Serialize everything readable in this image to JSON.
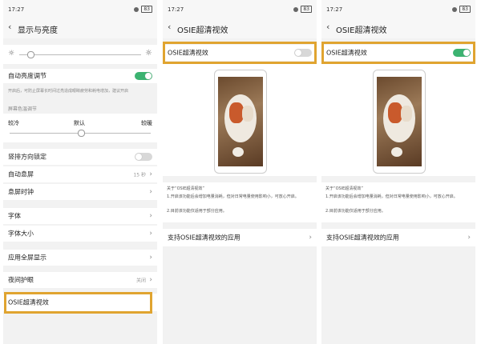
{
  "status": {
    "time": "17:27",
    "indicators": "",
    "battery": "83"
  },
  "screen1": {
    "title": "显示与亮度",
    "auto_brightness": "自动亮度调节",
    "auto_desc": "开启后，可防止屏幕长时间过亮造成眼睛疲劳和耗电增加，建议开启",
    "color_temp_label": "屏幕色温调节",
    "temp_cool": "较冷",
    "temp_default": "默认",
    "temp_warm": "较暖",
    "portrait_lock": "竖排方向锁定",
    "auto_sleep": "自动息屏",
    "auto_sleep_value": "15 秒",
    "sleep_timer": "息屏时钟",
    "font": "字体",
    "font_size": "字体大小",
    "fullscreen": "应用全屏显示",
    "night_mode": "夜间护眼",
    "night_value": "关闭",
    "osie": "OSIE超清视效"
  },
  "screen2": {
    "title": "OSIE超清视效",
    "toggle_label": "OSIE超清视效",
    "about_title": "关于“OSIE超清视效”",
    "about_1": "1.开启该功能后会增加电量消耗，但对日常电量使用影响小，可放心开启。",
    "about_2": "2.目前该功能仅适用于部分应用。",
    "supported": "支持OSIE超清视效的应用"
  },
  "screen3": {
    "title": "OSIE超清视效",
    "toggle_label": "OSIE超清视效",
    "about_title": "关于“OSIE超清视效”",
    "about_1": "1.开启该功能后会增加电量消耗，但对日常电量使用影响小，可放心开启。",
    "about_2": "2.目前该功能仅适用于部分应用。",
    "supported": "支持OSIE超清视效的应用"
  },
  "colors": {
    "highlight": "#e0a430",
    "toggle_on": "#3cb371"
  },
  "icons": [
    "back-chevron-icon",
    "sun-icon",
    "chevron-right-icon",
    "battery-icon"
  ]
}
